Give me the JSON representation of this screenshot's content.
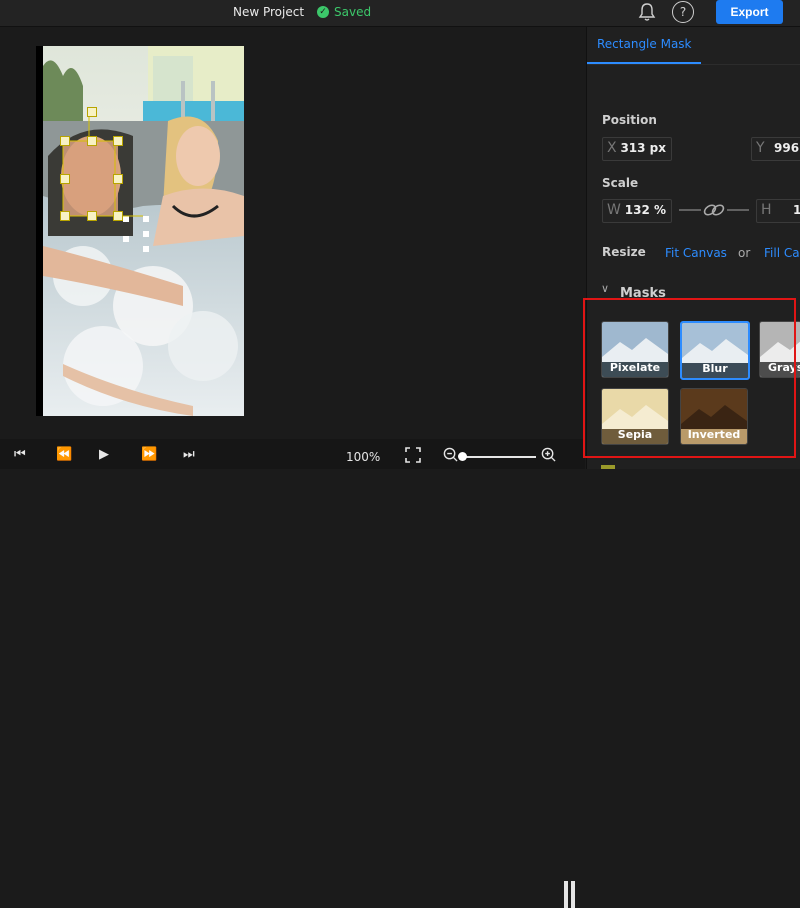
{
  "topbar": {
    "title": "New Project",
    "saved": "Saved",
    "export": "Export",
    "help": "?"
  },
  "controls": {
    "zoom": "100%"
  },
  "panel": {
    "tab": "Rectangle Mask",
    "position_label": "Position",
    "x_prefix": "X",
    "x_value": "313 px",
    "y_prefix": "Y",
    "y_value": "996",
    "scale_label": "Scale",
    "w_prefix": "W",
    "w_value": "132 %",
    "h_prefix": "H",
    "h_value": "1",
    "resize_label": "Resize",
    "fit_canvas": "Fit Canvas",
    "or": "or",
    "fill_canvas": "Fill Ca",
    "masks_label": "Masks",
    "masks": [
      {
        "label": "Pixelate"
      },
      {
        "label": "Blur"
      },
      {
        "label": "Grays"
      },
      {
        "label": "Sepia"
      },
      {
        "label": "Inverted"
      }
    ]
  },
  "colors": {
    "accent": "#1e7bf0",
    "saved": "#3cc76a",
    "highlight": "#e01515"
  }
}
